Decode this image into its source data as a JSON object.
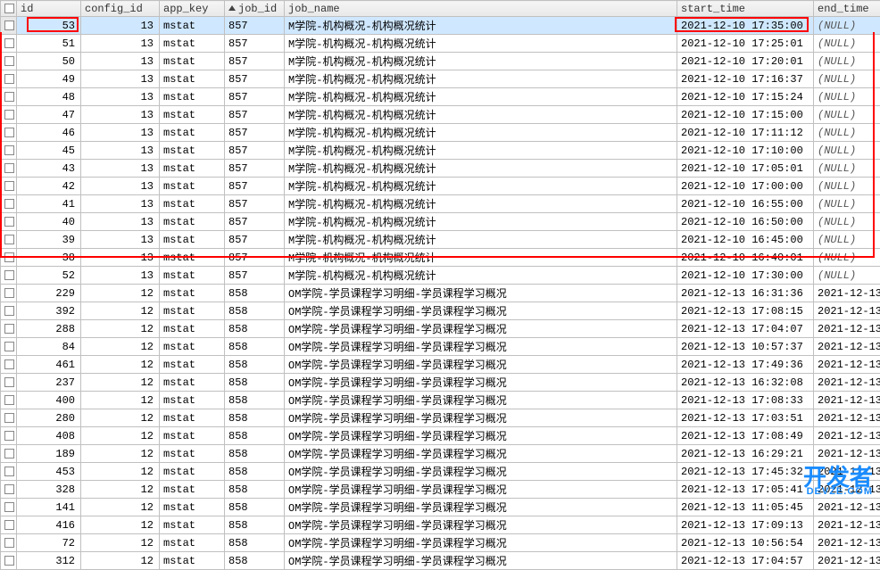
{
  "columns": {
    "id": "id",
    "config_id": "config_id",
    "app_key": "app_key",
    "job_id": "job_id",
    "job_name": "job_name",
    "start_time": "start_time",
    "end_time": "end_time"
  },
  "null_text": "(NULL)",
  "watermark": {
    "main": "开发者",
    "sub": "DEVZE.COM"
  },
  "rows": [
    {
      "id": 53,
      "cfg": 13,
      "app": "mstat",
      "job": 857,
      "name": "M学院-机构概况-机构概况统计",
      "start": "2021-12-10 17:35:00",
      "end": null,
      "sel": true
    },
    {
      "id": 51,
      "cfg": 13,
      "app": "mstat",
      "job": 857,
      "name": "M学院-机构概况-机构概况统计",
      "start": "2021-12-10 17:25:01",
      "end": null
    },
    {
      "id": 50,
      "cfg": 13,
      "app": "mstat",
      "job": 857,
      "name": "M学院-机构概况-机构概况统计",
      "start": "2021-12-10 17:20:01",
      "end": null
    },
    {
      "id": 49,
      "cfg": 13,
      "app": "mstat",
      "job": 857,
      "name": "M学院-机构概况-机构概况统计",
      "start": "2021-12-10 17:16:37",
      "end": null
    },
    {
      "id": 48,
      "cfg": 13,
      "app": "mstat",
      "job": 857,
      "name": "M学院-机构概况-机构概况统计",
      "start": "2021-12-10 17:15:24",
      "end": null
    },
    {
      "id": 47,
      "cfg": 13,
      "app": "mstat",
      "job": 857,
      "name": "M学院-机构概况-机构概况统计",
      "start": "2021-12-10 17:15:00",
      "end": null
    },
    {
      "id": 46,
      "cfg": 13,
      "app": "mstat",
      "job": 857,
      "name": "M学院-机构概况-机构概况统计",
      "start": "2021-12-10 17:11:12",
      "end": null
    },
    {
      "id": 45,
      "cfg": 13,
      "app": "mstat",
      "job": 857,
      "name": "M学院-机构概况-机构概况统计",
      "start": "2021-12-10 17:10:00",
      "end": null
    },
    {
      "id": 43,
      "cfg": 13,
      "app": "mstat",
      "job": 857,
      "name": "M学院-机构概况-机构概况统计",
      "start": "2021-12-10 17:05:01",
      "end": null
    },
    {
      "id": 42,
      "cfg": 13,
      "app": "mstat",
      "job": 857,
      "name": "M学院-机构概况-机构概况统计",
      "start": "2021-12-10 17:00:00",
      "end": null
    },
    {
      "id": 41,
      "cfg": 13,
      "app": "mstat",
      "job": 857,
      "name": "M学院-机构概况-机构概况统计",
      "start": "2021-12-10 16:55:00",
      "end": null
    },
    {
      "id": 40,
      "cfg": 13,
      "app": "mstat",
      "job": 857,
      "name": "M学院-机构概况-机构概况统计",
      "start": "2021-12-10 16:50:00",
      "end": null
    },
    {
      "id": 39,
      "cfg": 13,
      "app": "mstat",
      "job": 857,
      "name": "M学院-机构概况-机构概况统计",
      "start": "2021-12-10 16:45:00",
      "end": null
    },
    {
      "id": 38,
      "cfg": 13,
      "app": "mstat",
      "job": 857,
      "name": "M学院-机构概况-机构概况统计",
      "start": "2021-12-10 16:40:01",
      "end": null
    },
    {
      "id": 52,
      "cfg": 13,
      "app": "mstat",
      "job": 857,
      "name": "M学院-机构概况-机构概况统计",
      "start": "2021-12-10 17:30:00",
      "end": null
    },
    {
      "id": 229,
      "cfg": 12,
      "app": "mstat",
      "job": 858,
      "name": "OM学院-学员课程学习明细-学员课程学习概况",
      "start": "2021-12-13 16:31:36",
      "end": "2021-12-13"
    },
    {
      "id": 392,
      "cfg": 12,
      "app": "mstat",
      "job": 858,
      "name": "OM学院-学员课程学习明细-学员课程学习概况",
      "start": "2021-12-13 17:08:15",
      "end": "2021-12-13"
    },
    {
      "id": 288,
      "cfg": 12,
      "app": "mstat",
      "job": 858,
      "name": "OM学院-学员课程学习明细-学员课程学习概况",
      "start": "2021-12-13 17:04:07",
      "end": "2021-12-13"
    },
    {
      "id": 84,
      "cfg": 12,
      "app": "mstat",
      "job": 858,
      "name": "OM学院-学员课程学习明细-学员课程学习概况",
      "start": "2021-12-13 10:57:37",
      "end": "2021-12-13"
    },
    {
      "id": 461,
      "cfg": 12,
      "app": "mstat",
      "job": 858,
      "name": "OM学院-学员课程学习明细-学员课程学习概况",
      "start": "2021-12-13 17:49:36",
      "end": "2021-12-13"
    },
    {
      "id": 237,
      "cfg": 12,
      "app": "mstat",
      "job": 858,
      "name": "OM学院-学员课程学习明细-学员课程学习概况",
      "start": "2021-12-13 16:32:08",
      "end": "2021-12-13"
    },
    {
      "id": 400,
      "cfg": 12,
      "app": "mstat",
      "job": 858,
      "name": "OM学院-学员课程学习明细-学员课程学习概况",
      "start": "2021-12-13 17:08:33",
      "end": "2021-12-13"
    },
    {
      "id": 280,
      "cfg": 12,
      "app": "mstat",
      "job": 858,
      "name": "OM学院-学员课程学习明细-学员课程学习概况",
      "start": "2021-12-13 17:03:51",
      "end": "2021-12-13"
    },
    {
      "id": 408,
      "cfg": 12,
      "app": "mstat",
      "job": 858,
      "name": "OM学院-学员课程学习明细-学员课程学习概况",
      "start": "2021-12-13 17:08:49",
      "end": "2021-12-13"
    },
    {
      "id": 189,
      "cfg": 12,
      "app": "mstat",
      "job": 858,
      "name": "OM学院-学员课程学习明细-学员课程学习概况",
      "start": "2021-12-13 16:29:21",
      "end": "2021-12-13"
    },
    {
      "id": 453,
      "cfg": 12,
      "app": "mstat",
      "job": 858,
      "name": "OM学院-学员课程学习明细-学员课程学习概况",
      "start": "2021-12-13 17:45:32",
      "end": "2021-12-13"
    },
    {
      "id": 328,
      "cfg": 12,
      "app": "mstat",
      "job": 858,
      "name": "OM学院-学员课程学习明细-学员课程学习概况",
      "start": "2021-12-13 17:05:41",
      "end": "2021-12-13"
    },
    {
      "id": 141,
      "cfg": 12,
      "app": "mstat",
      "job": 858,
      "name": "OM学院-学员课程学习明细-学员课程学习概况",
      "start": "2021-12-13 11:05:45",
      "end": "2021-12-13"
    },
    {
      "id": 416,
      "cfg": 12,
      "app": "mstat",
      "job": 858,
      "name": "OM学院-学员课程学习明细-学员课程学习概况",
      "start": "2021-12-13 17:09:13",
      "end": "2021-12-13"
    },
    {
      "id": 72,
      "cfg": 12,
      "app": "mstat",
      "job": 858,
      "name": "OM学院-学员课程学习明细-学员课程学习概况",
      "start": "2021-12-13 10:56:54",
      "end": "2021-12-13"
    },
    {
      "id": 312,
      "cfg": 12,
      "app": "mstat",
      "job": 858,
      "name": "OM学院-学员课程学习明细-学员课程学习概况",
      "start": "2021-12-13 17:04:57",
      "end": "2021-12-13"
    }
  ]
}
